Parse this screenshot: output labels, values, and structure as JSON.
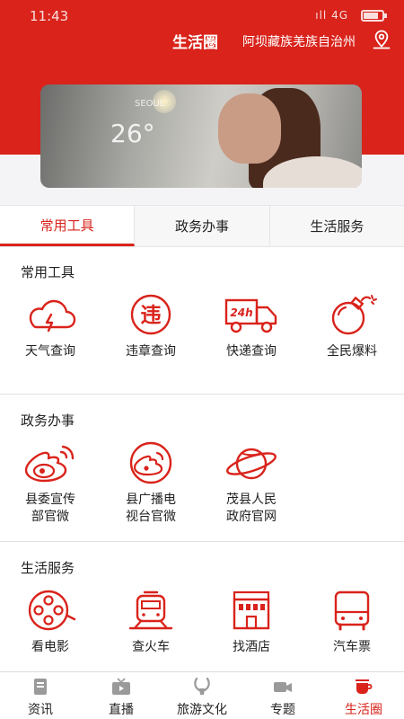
{
  "status_bar": {
    "time": "11:43",
    "network": "4G"
  },
  "header": {
    "title": "生活圈",
    "location": "阿坝藏族羌族自治州",
    "location_icon": "location-pin-icon"
  },
  "banner": {
    "city": "SEOUL",
    "temperature": "26°"
  },
  "tabs": [
    {
      "label": "常用工具",
      "active": true
    },
    {
      "label": "政务办事",
      "active": false
    },
    {
      "label": "生活服务",
      "active": false
    }
  ],
  "sections": {
    "tools": {
      "title": "常用工具",
      "items": [
        {
          "label": "天气查询",
          "icon": "weather-cloud-icon"
        },
        {
          "label": "违章查询",
          "icon": "violation-icon"
        },
        {
          "label": "快递查询",
          "icon": "delivery-truck-icon"
        },
        {
          "label": "全民爆料",
          "icon": "bomb-icon"
        }
      ]
    },
    "gov": {
      "title": "政务办事",
      "items": [
        {
          "label": "县委宣传部官微",
          "line1": "县委宣传",
          "line2": "部官微",
          "icon": "weibo-icon"
        },
        {
          "label": "县广播电视台官微",
          "line1": "县广播电",
          "line2": "视台官微",
          "icon": "weibo-icon"
        },
        {
          "label": "茂县人民政府官网",
          "line1": "茂县人民",
          "line2": "政府官网",
          "icon": "globe-icon"
        }
      ]
    },
    "life": {
      "title": "生活服务",
      "items": [
        {
          "label": "看电影",
          "icon": "film-reel-icon"
        },
        {
          "label": "查火车",
          "icon": "train-icon"
        },
        {
          "label": "找酒店",
          "icon": "hotel-icon"
        },
        {
          "label": "汽车票",
          "icon": "bus-icon"
        }
      ]
    }
  },
  "bottom_nav": [
    {
      "label": "资讯",
      "icon": "news-icon",
      "active": false
    },
    {
      "label": "直播",
      "icon": "tv-icon",
      "active": false
    },
    {
      "label": "旅游文化",
      "icon": "antelope-icon",
      "active": false
    },
    {
      "label": "专题",
      "icon": "video-camera-icon",
      "active": false
    },
    {
      "label": "生活圈",
      "icon": "coffee-cup-icon",
      "active": true
    }
  ],
  "colors": {
    "brand_red": "#d9231b",
    "text": "#222222",
    "inactive_icon": "#9a9a9a"
  }
}
